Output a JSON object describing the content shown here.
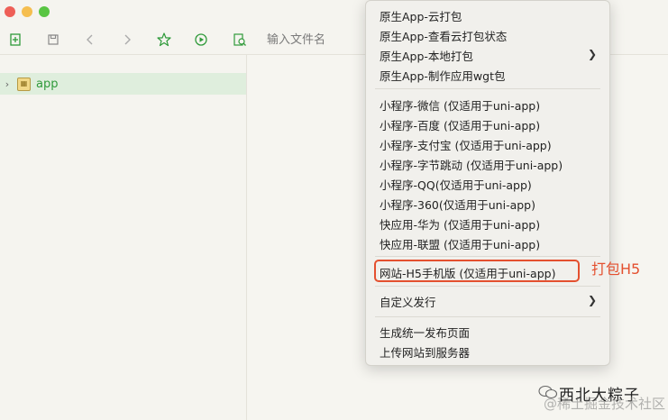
{
  "toolbar": {
    "search_placeholder": "输入文件名"
  },
  "sidebar": {
    "items": [
      {
        "label": "app",
        "icon": "folder-icon"
      }
    ]
  },
  "menu": {
    "group1": [
      {
        "label": "原生App-云打包"
      },
      {
        "label": "原生App-查看云打包状态"
      },
      {
        "label": "原生App-本地打包",
        "submenu": true
      },
      {
        "label": "原生App-制作应用wgt包"
      }
    ],
    "group2": [
      {
        "label": "小程序-微信 (仅适用于uni-app)"
      },
      {
        "label": "小程序-百度 (仅适用于uni-app)"
      },
      {
        "label": "小程序-支付宝 (仅适用于uni-app)"
      },
      {
        "label": "小程序-字节跳动 (仅适用于uni-app)"
      },
      {
        "label": "小程序-QQ(仅适用于uni-app)"
      },
      {
        "label": "小程序-360(仅适用于uni-app)"
      },
      {
        "label": "快应用-华为 (仅适用于uni-app)"
      },
      {
        "label": "快应用-联盟 (仅适用于uni-app)"
      }
    ],
    "group3": [
      {
        "label": "网站-H5手机版 (仅适用于uni-app)"
      }
    ],
    "group4": [
      {
        "label": "自定义发行",
        "submenu": true
      }
    ],
    "group5": [
      {
        "label": "生成统一发布页面"
      },
      {
        "label": "上传网站到服务器"
      }
    ]
  },
  "annotation": {
    "text": "打包H5",
    "color": "#e4502f"
  },
  "watermark": {
    "main": "西北大粽子",
    "sub": "@稀土掘金技术社区"
  },
  "colors": {
    "accent_green": "#2f9a3a",
    "highlight_red": "#e4502f",
    "selected_row": "#dfeedd"
  }
}
